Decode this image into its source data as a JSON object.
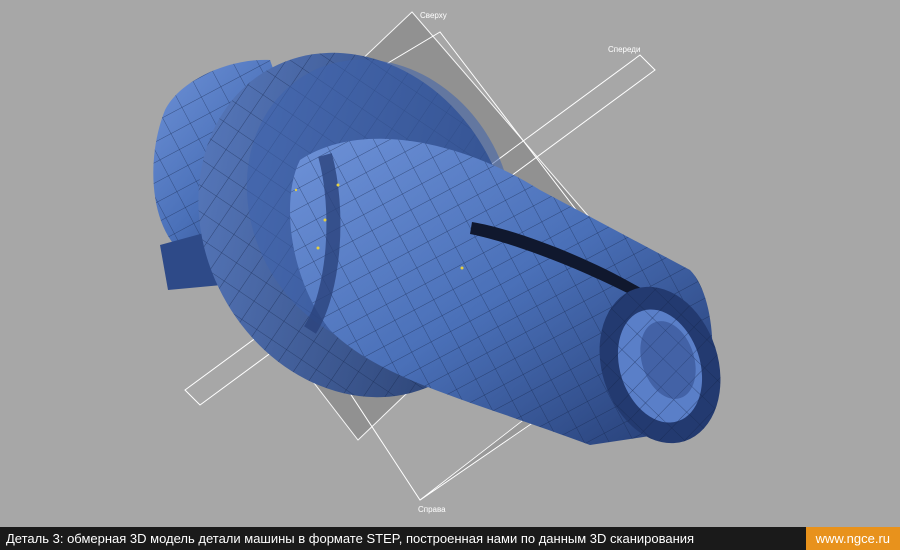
{
  "viewport": {
    "plane_labels": {
      "top": "Сверху",
      "front": "Спереди",
      "right": "Справа"
    }
  },
  "caption": {
    "text": "Деталь 3: обмерная 3D модель детали машины в формате STEP, построенная нами по данным 3D сканирования",
    "site": "www.ngce.ru"
  },
  "colors": {
    "background": "#a7a7a7",
    "model": "#4a70b8",
    "planes": "#ffffff",
    "caption_bar": "#1a1a1a",
    "site_badge": "#e8921c"
  }
}
